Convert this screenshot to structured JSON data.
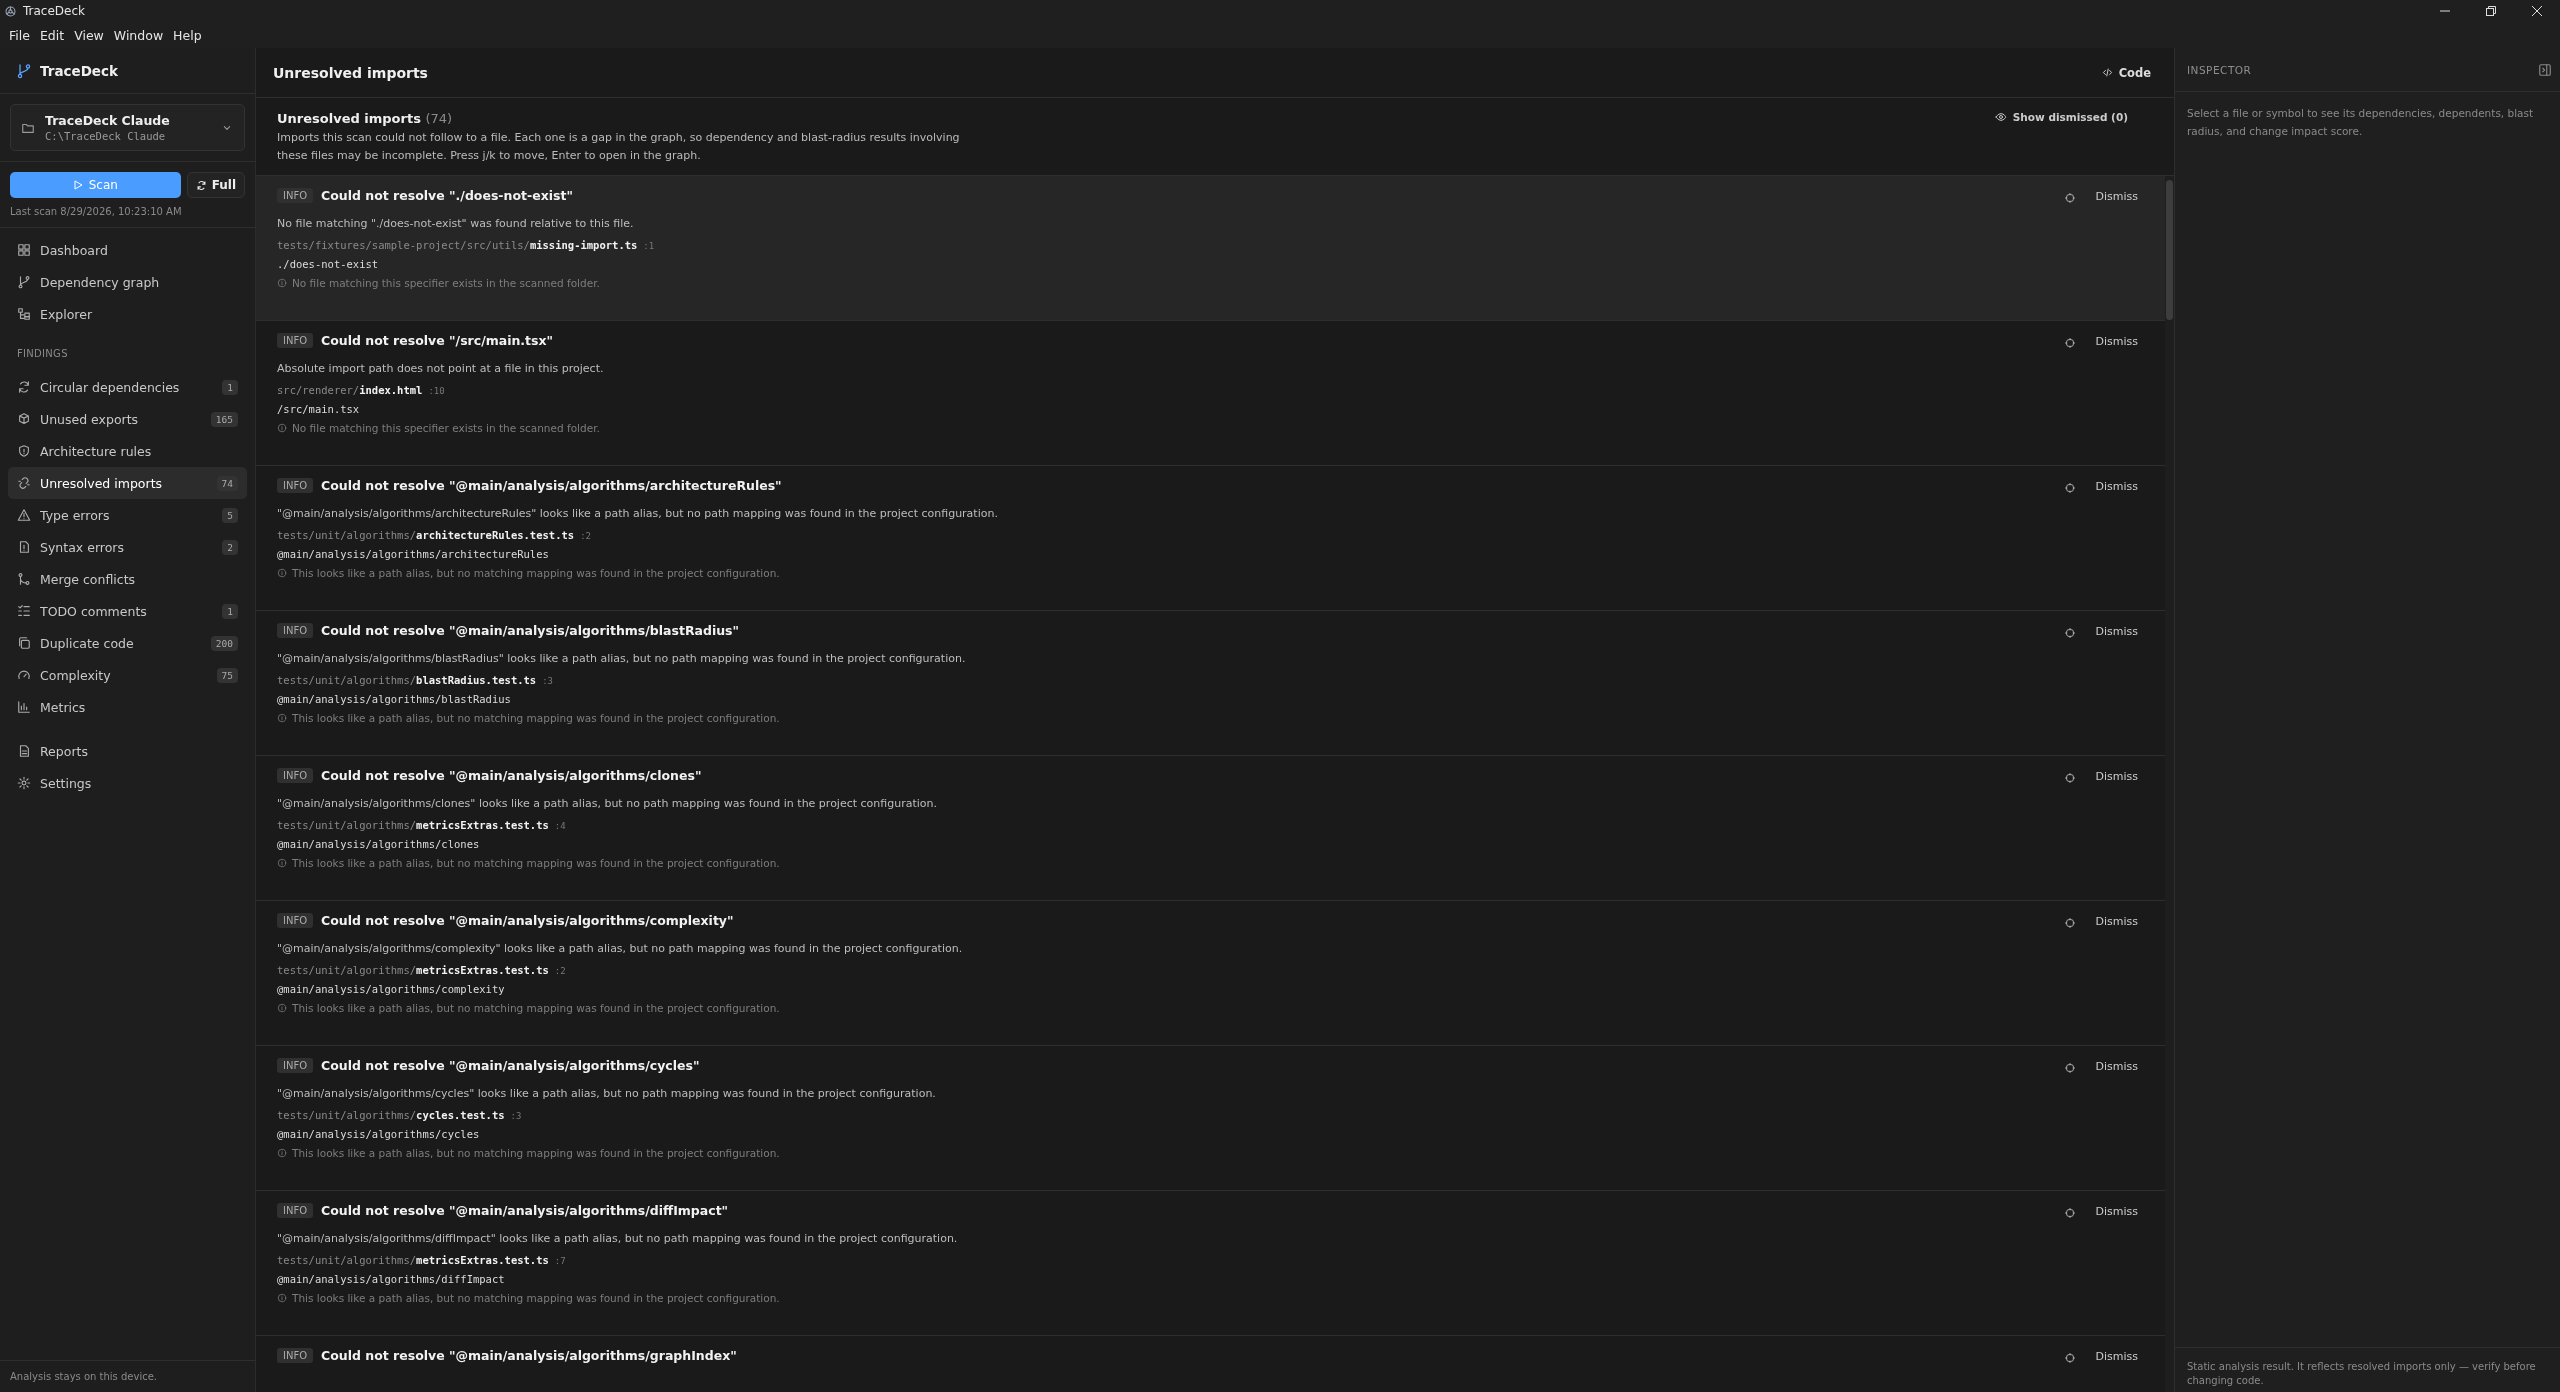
{
  "window": {
    "title": "TraceDeck"
  },
  "menu": [
    "File",
    "Edit",
    "View",
    "Window",
    "Help"
  ],
  "sidebar": {
    "brand": "TraceDeck",
    "project": {
      "name": "TraceDeck Claude",
      "path": "C:\\TraceDeck Claude"
    },
    "scan_button": "Scan",
    "full_button": "Full",
    "last_scan": "Last scan 8/29/2026, 10:23:10 AM",
    "nav": [
      {
        "label": "Dashboard",
        "selected": false
      },
      {
        "label": "Dependency graph",
        "selected": false
      },
      {
        "label": "Explorer",
        "selected": false
      }
    ],
    "findings_heading": "FINDINGS",
    "findings": [
      {
        "label": "Circular dependencies",
        "count": "1",
        "selected": false
      },
      {
        "label": "Unused exports",
        "count": "165",
        "selected": false
      },
      {
        "label": "Architecture rules",
        "selected": false
      },
      {
        "label": "Unresolved imports",
        "count": "74",
        "selected": true
      },
      {
        "label": "Type errors",
        "count": "5",
        "selected": false
      },
      {
        "label": "Syntax errors",
        "count": "2",
        "selected": false
      },
      {
        "label": "Merge conflicts",
        "selected": false
      },
      {
        "label": "TODO comments",
        "count": "1",
        "selected": false
      },
      {
        "label": "Duplicate code",
        "count": "200",
        "selected": false
      },
      {
        "label": "Complexity",
        "count": "75",
        "selected": false
      },
      {
        "label": "Metrics",
        "selected": false
      }
    ],
    "bottom": [
      {
        "label": "Reports",
        "selected": false
      },
      {
        "label": "Settings",
        "selected": false
      }
    ],
    "footer": "Analysis stays on this device."
  },
  "main": {
    "title": "Unresolved imports",
    "code_button": "Code",
    "summary": {
      "title": "Unresolved imports",
      "count": "(74)",
      "text": "Imports this scan could not follow to a file. Each one is a gap in the graph, so dependency and blast-radius results involving these files may be incomplete. Press j/k to move, Enter to open in the graph.",
      "show_dismissed": "Show dismissed (0)"
    },
    "items": [
      {
        "badge": "INFO",
        "title": "Could not resolve \"./does-not-exist\"",
        "description": "No file matching \"./does-not-exist\" was found relative to this file.",
        "path_dir": "tests/fixtures/sample-project/src/utils/",
        "path_file": "missing-import.ts",
        "line": ":1",
        "specifier": "./does-not-exist",
        "note": "No file matching this specifier exists in the scanned folder.",
        "dismiss": "Dismiss",
        "selected": true
      },
      {
        "badge": "INFO",
        "title": "Could not resolve \"/src/main.tsx\"",
        "description": "Absolute import path does not point at a file in this project.",
        "path_dir": "src/renderer/",
        "path_file": "index.html",
        "line": ":10",
        "specifier": "/src/main.tsx",
        "note": "No file matching this specifier exists in the scanned folder.",
        "dismiss": "Dismiss",
        "selected": false
      },
      {
        "badge": "INFO",
        "title": "Could not resolve \"@main/analysis/algorithms/architectureRules\"",
        "description": "\"@main/analysis/algorithms/architectureRules\" looks like a path alias, but no path mapping was found in the project configuration.",
        "path_dir": "tests/unit/algorithms/",
        "path_file": "architectureRules.test.ts",
        "line": ":2",
        "specifier": "@main/analysis/algorithms/architectureRules",
        "note": "This looks like a path alias, but no matching mapping was found in the project configuration.",
        "dismiss": "Dismiss",
        "selected": false
      },
      {
        "badge": "INFO",
        "title": "Could not resolve \"@main/analysis/algorithms/blastRadius\"",
        "description": "\"@main/analysis/algorithms/blastRadius\" looks like a path alias, but no path mapping was found in the project configuration.",
        "path_dir": "tests/unit/algorithms/",
        "path_file": "blastRadius.test.ts",
        "line": ":3",
        "specifier": "@main/analysis/algorithms/blastRadius",
        "note": "This looks like a path alias, but no matching mapping was found in the project configuration.",
        "dismiss": "Dismiss",
        "selected": false
      },
      {
        "badge": "INFO",
        "title": "Could not resolve \"@main/analysis/algorithms/clones\"",
        "description": "\"@main/analysis/algorithms/clones\" looks like a path alias, but no path mapping was found in the project configuration.",
        "path_dir": "tests/unit/algorithms/",
        "path_file": "metricsExtras.test.ts",
        "line": ":4",
        "specifier": "@main/analysis/algorithms/clones",
        "note": "This looks like a path alias, but no matching mapping was found in the project configuration.",
        "dismiss": "Dismiss",
        "selected": false
      },
      {
        "badge": "INFO",
        "title": "Could not resolve \"@main/analysis/algorithms/complexity\"",
        "description": "\"@main/analysis/algorithms/complexity\" looks like a path alias, but no path mapping was found in the project configuration.",
        "path_dir": "tests/unit/algorithms/",
        "path_file": "metricsExtras.test.ts",
        "line": ":2",
        "specifier": "@main/analysis/algorithms/complexity",
        "note": "This looks like a path alias, but no matching mapping was found in the project configuration.",
        "dismiss": "Dismiss",
        "selected": false
      },
      {
        "badge": "INFO",
        "title": "Could not resolve \"@main/analysis/algorithms/cycles\"",
        "description": "\"@main/analysis/algorithms/cycles\" looks like a path alias, but no path mapping was found in the project configuration.",
        "path_dir": "tests/unit/algorithms/",
        "path_file": "cycles.test.ts",
        "line": ":3",
        "specifier": "@main/analysis/algorithms/cycles",
        "note": "This looks like a path alias, but no matching mapping was found in the project configuration.",
        "dismiss": "Dismiss",
        "selected": false
      },
      {
        "badge": "INFO",
        "title": "Could not resolve \"@main/analysis/algorithms/diffImpact\"",
        "description": "\"@main/analysis/algorithms/diffImpact\" looks like a path alias, but no path mapping was found in the project configuration.",
        "path_dir": "tests/unit/algorithms/",
        "path_file": "metricsExtras.test.ts",
        "line": ":7",
        "specifier": "@main/analysis/algorithms/diffImpact",
        "note": "This looks like a path alias, but no matching mapping was found in the project configuration.",
        "dismiss": "Dismiss",
        "selected": false
      },
      {
        "badge": "INFO",
        "title": "Could not resolve \"@main/analysis/algorithms/graphIndex\"",
        "dismiss": "Dismiss",
        "selected": false
      }
    ]
  },
  "inspector": {
    "title": "INSPECTOR",
    "hint": "Select a file or symbol to see its dependencies, dependents, blast radius, and change impact score.",
    "footer": "Static analysis result. It reflects resolved imports only — verify before changing code."
  }
}
